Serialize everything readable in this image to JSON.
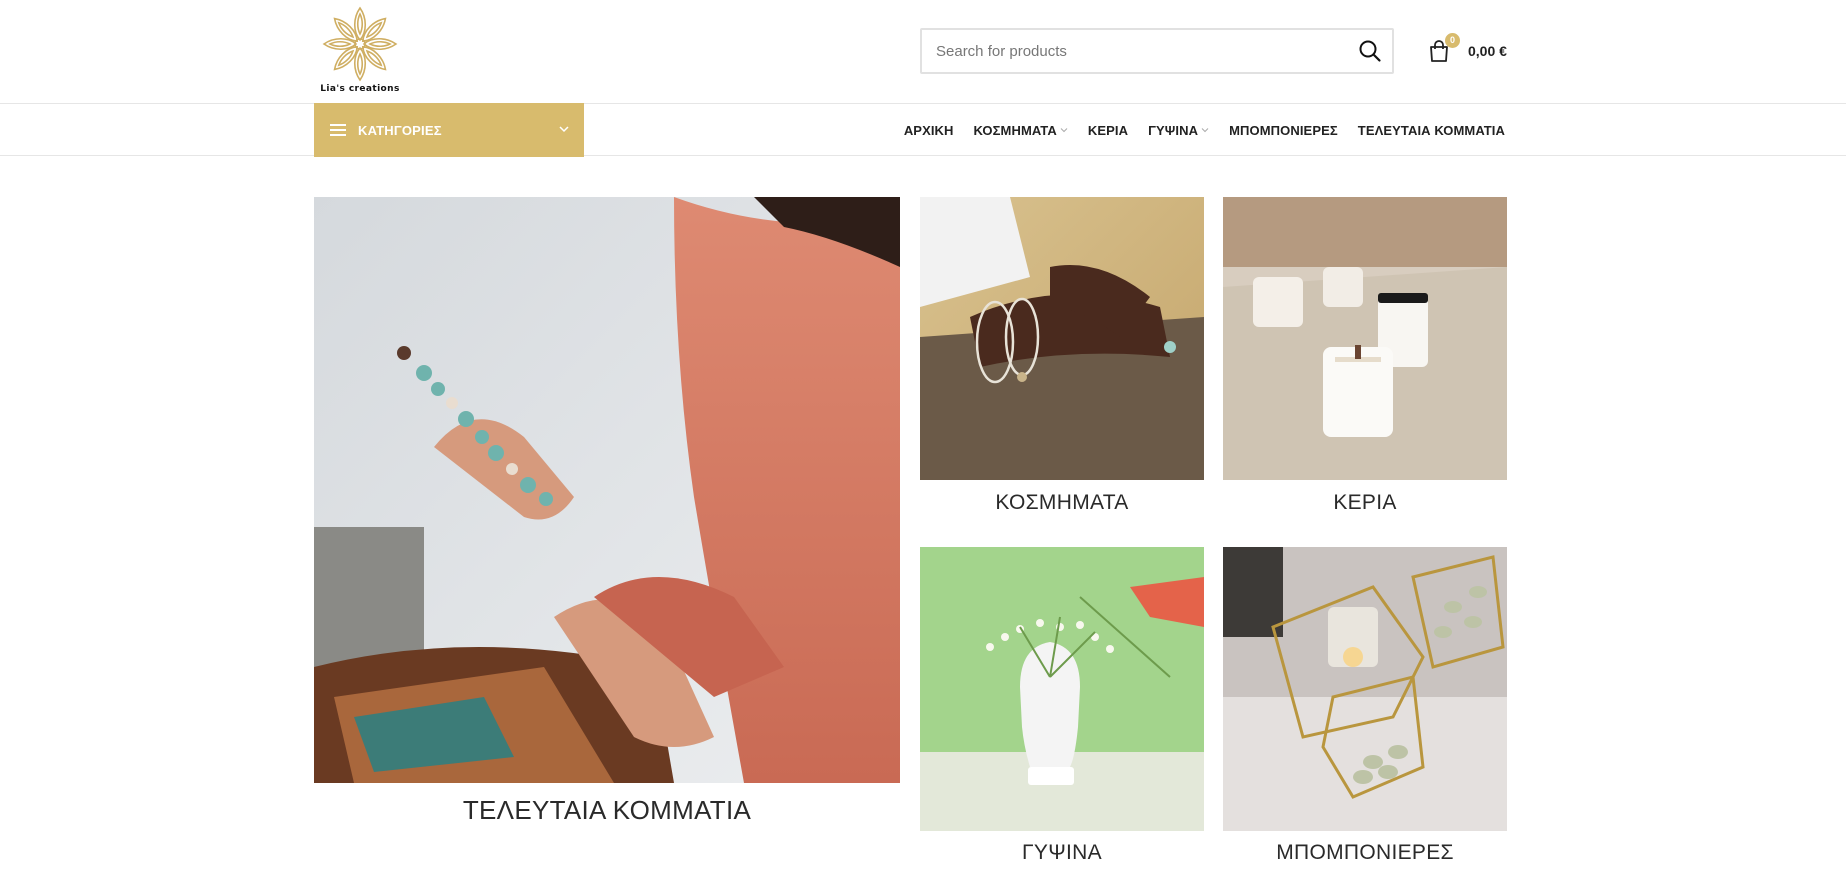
{
  "header": {
    "logo_text": "Lia's creations",
    "search": {
      "placeholder": "Search for products"
    },
    "cart": {
      "count": "0",
      "total": "0,00 €"
    }
  },
  "nav": {
    "categories_label": "ΚΑΤΗΓΟΡΙΕΣ",
    "items": [
      {
        "label": "ΑΡΧΙΚΗ",
        "has_dropdown": false
      },
      {
        "label": "ΚΟΣΜΗΜΑΤΑ",
        "has_dropdown": true
      },
      {
        "label": "ΚΕΡΙΑ",
        "has_dropdown": false
      },
      {
        "label": "ΓΥΨΙΝΑ",
        "has_dropdown": true
      },
      {
        "label": "ΜΠΟΜΠΟΝΙΕΡΕΣ",
        "has_dropdown": false
      },
      {
        "label": "ΤΕΛΕΥΤΑΙΑ ΚΟΜΜΑΤΙΑ",
        "has_dropdown": false
      }
    ]
  },
  "categories": {
    "featured": {
      "title": "ΤΕΛΕΥΤΑΙΑ ΚΟΜΜΑΤΙΑ"
    },
    "jewelry": {
      "title": "ΚΟΣΜΗΜΑΤΑ"
    },
    "candles": {
      "title": "ΚΕΡΙΑ"
    },
    "plaster": {
      "title": "ΓΥΨΙΝΑ"
    },
    "favors": {
      "title": "ΜΠΟΜΠΟΝΙΕΡΕΣ"
    }
  },
  "colors": {
    "accent": "#d8bb6d",
    "text": "#242424",
    "border": "#e1e1e1"
  },
  "icons": [
    "logo-mandala-icon",
    "search-icon",
    "cart-icon",
    "menu-icon",
    "chevron-down-icon"
  ]
}
